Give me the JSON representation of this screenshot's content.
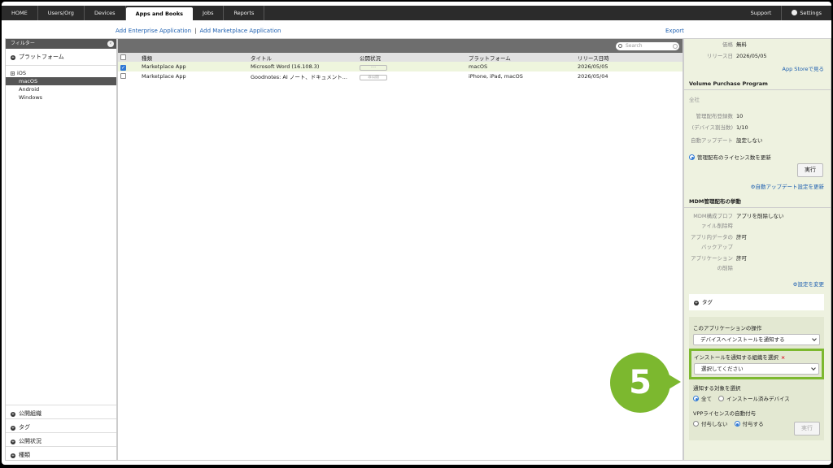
{
  "nav": {
    "items": [
      "HOME",
      "Users/Org",
      "Devices",
      "Apps and Books",
      "Jobs",
      "Reports"
    ],
    "active_index": 3,
    "support": "Support",
    "settings": "Settings"
  },
  "actions": {
    "add_enterprise": "Add Enterprise Application",
    "add_marketplace": "Add Marketplace Application",
    "separator": "|",
    "export": "Export"
  },
  "filter": {
    "header": "フィルター",
    "platform_section": "プラットフォーム",
    "tree": [
      "iOS",
      "macOS",
      "Android",
      "Windows"
    ],
    "selected_tree": "macOS",
    "bottom_sections": [
      "公開組織",
      "タグ",
      "公開状況",
      "種類"
    ]
  },
  "table": {
    "search_placeholder": "Search",
    "columns": [
      "種類",
      "タイトル",
      "公開状況",
      "プラットフォーム",
      "リリース日時"
    ],
    "rows": [
      {
        "checked": true,
        "type": "Marketplace App",
        "title": "Microsoft Word (16.108.3)",
        "status": "----",
        "platform": "macOS",
        "release": "2026/05/05"
      },
      {
        "checked": false,
        "type": "Marketplace App",
        "title": "Goodnotes: AI ノート、ドキュメント...",
        "status": "非公開",
        "platform": "iPhone, iPad, macOS",
        "release": "2026/05/04"
      }
    ]
  },
  "details": {
    "price_label": "価格",
    "price_value": "無料",
    "release_label": "リリース日",
    "release_value": "2026/05/05",
    "app_store_link": "App Storeで見る",
    "vpp_header": "Volume Purchase Program",
    "vpp_scope": "全社",
    "licenses_label": "管理配布登録数",
    "licenses_value": "10",
    "devices_label": "(デバイス割当数)",
    "devices_value": "1/10",
    "auto_update_label": "自動アップデート",
    "auto_update_value": "設定しない",
    "update_license_radio": "管理配布のライセンス数を更新",
    "execute": "実行",
    "update_auto_link": "自動アップデート設定を更新",
    "mdm_header": "MDM管理配布の挙動",
    "mdm_rows": [
      {
        "label1": "MDM構成プロフ",
        "label2": "ァイル削除時",
        "value": "アプリを削除しない"
      },
      {
        "label1": "アプリ内データの",
        "label2": "バックアップ",
        "value": "許可"
      },
      {
        "label1": "アプリケーション",
        "label2": "の削除",
        "value": "許可"
      }
    ],
    "change_settings_link": "設定を変更",
    "tag_section": "タグ",
    "operation_label": "このアプリケーションの操作",
    "operation_value": "デバイスへインストールを通知する",
    "org_label": "インストールを通知する組織を選択",
    "org_required": "×",
    "org_value": "選択してください",
    "target_label": "通知する対象を選択",
    "target_all": "全て",
    "target_installed": "インストール済みデバイス",
    "vpp_auto_label": "VPPライセンスの自動付与",
    "vpp_auto_no": "付与しない",
    "vpp_auto_yes": "付与する",
    "execute_disabled": "実行"
  },
  "step_badge": "5",
  "colors": {
    "accent_green": "#7cb82f",
    "link_blue": "#1d5fb0",
    "nav_dark": "#2b2b2b"
  }
}
